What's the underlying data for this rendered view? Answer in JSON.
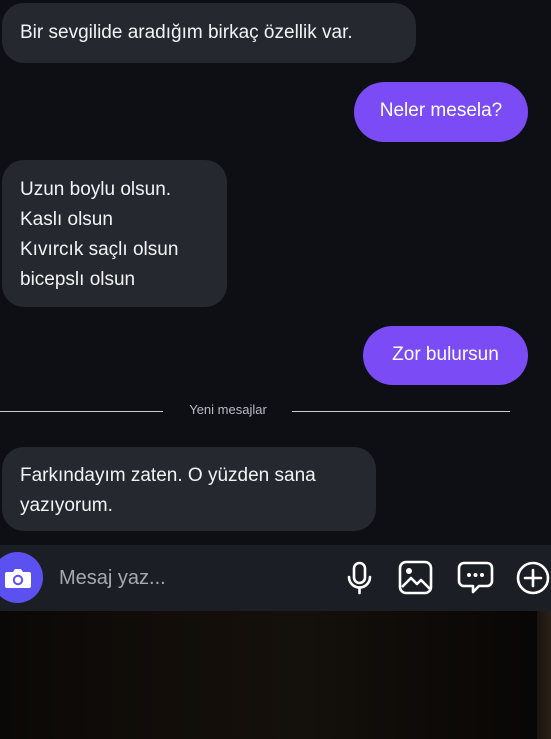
{
  "messages": {
    "m1": "Bir sevgilide aradığım birkaç özellik var.",
    "m2": "Neler mesela?",
    "m3": "Uzun boylu olsun.\nKaslı olsun\nKıvırcık saçlı olsun\nbicepslı olsun",
    "m4": "Zor bulursun",
    "m5": "Farkındayım zaten. O yüzden sana\nyazıyorum."
  },
  "divider": {
    "label": "Yeni mesajlar"
  },
  "composer": {
    "placeholder": "Mesaj yaz...",
    "icons": [
      "camera-icon",
      "microphone-icon",
      "image-icon",
      "sticker-icon",
      "plus-icon"
    ]
  },
  "colors": {
    "accent": "#7b4cf5",
    "camera_button": "#5b50f0",
    "incoming_bubble": "#26282f",
    "background": "#0d0f15",
    "composer_bg": "#1c1e25"
  }
}
